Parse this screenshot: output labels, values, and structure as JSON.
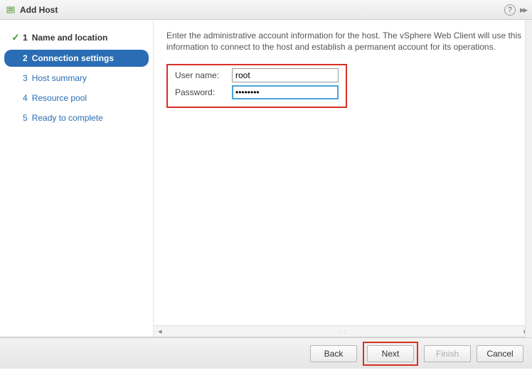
{
  "title": "Add Host",
  "help_tooltip": "?",
  "expand_glyph": "▸▸",
  "sidebar": {
    "items": [
      {
        "num": "1",
        "label": "Name and location",
        "state": "completed"
      },
      {
        "num": "2",
        "label": "Connection settings",
        "state": "active"
      },
      {
        "num": "3",
        "label": "Host summary",
        "state": "pending"
      },
      {
        "num": "4",
        "label": "Resource pool",
        "state": "pending"
      },
      {
        "num": "5",
        "label": "Ready to complete",
        "state": "pending"
      }
    ]
  },
  "content": {
    "instruction": "Enter the administrative account information for the host. The vSphere Web Client will use this information to connect to the host and establish a permanent account for its operations.",
    "username_label": "User name:",
    "username_value": "root",
    "password_label": "Password:",
    "password_value": "********"
  },
  "footer": {
    "back": "Back",
    "next": "Next",
    "finish": "Finish",
    "cancel": "Cancel"
  },
  "icons": {
    "host": "host-icon",
    "help": "help-icon",
    "expand": "expand-icon",
    "check": "✓"
  }
}
